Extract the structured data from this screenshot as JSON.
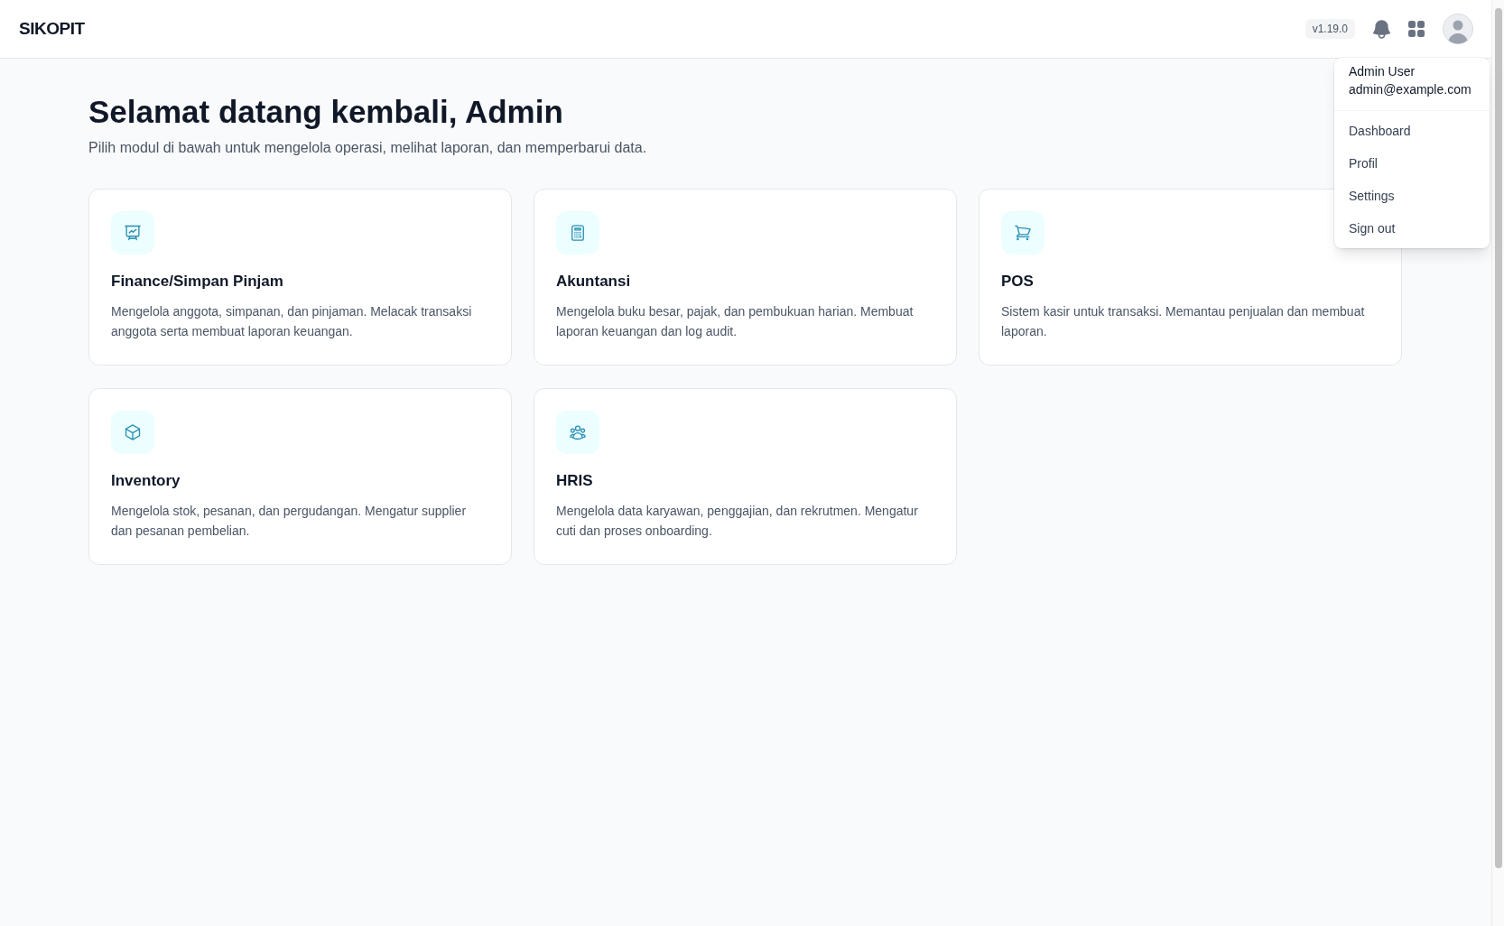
{
  "header": {
    "logo": "SIKOPIT",
    "version": "v1.19.0"
  },
  "user_menu": {
    "name": "Admin User",
    "email": "admin@example.com",
    "items": [
      "Dashboard",
      "Profil",
      "Settings",
      "Sign out"
    ]
  },
  "welcome": {
    "title": "Selamat datang kembali, Admin",
    "subtitle": "Pilih modul di bawah untuk mengelola operasi, melihat laporan, dan memperbarui data."
  },
  "modules": [
    {
      "kind": "chart",
      "title": "Finance/Simpan Pinjam",
      "description": "Mengelola anggota, simpanan, dan pinjaman. Melacak transaksi anggota serta membuat laporan keuangan."
    },
    {
      "kind": "calculator",
      "title": "Akuntansi",
      "description": "Mengelola buku besar, pajak, dan pembukuan harian. Membuat laporan keuangan dan log audit."
    },
    {
      "kind": "cart",
      "title": "POS",
      "description": "Sistem kasir untuk transaksi. Memantau penjualan dan membuat laporan."
    },
    {
      "kind": "box",
      "title": "Inventory",
      "description": "Mengelola stok, pesanan, dan pergudangan. Mengatur supplier dan pesanan pembelian."
    },
    {
      "kind": "team",
      "title": "HRIS",
      "description": "Mengelola data karyawan, penggajian, dan rekrutmen. Mengatur cuti dan proses onboarding."
    }
  ]
}
